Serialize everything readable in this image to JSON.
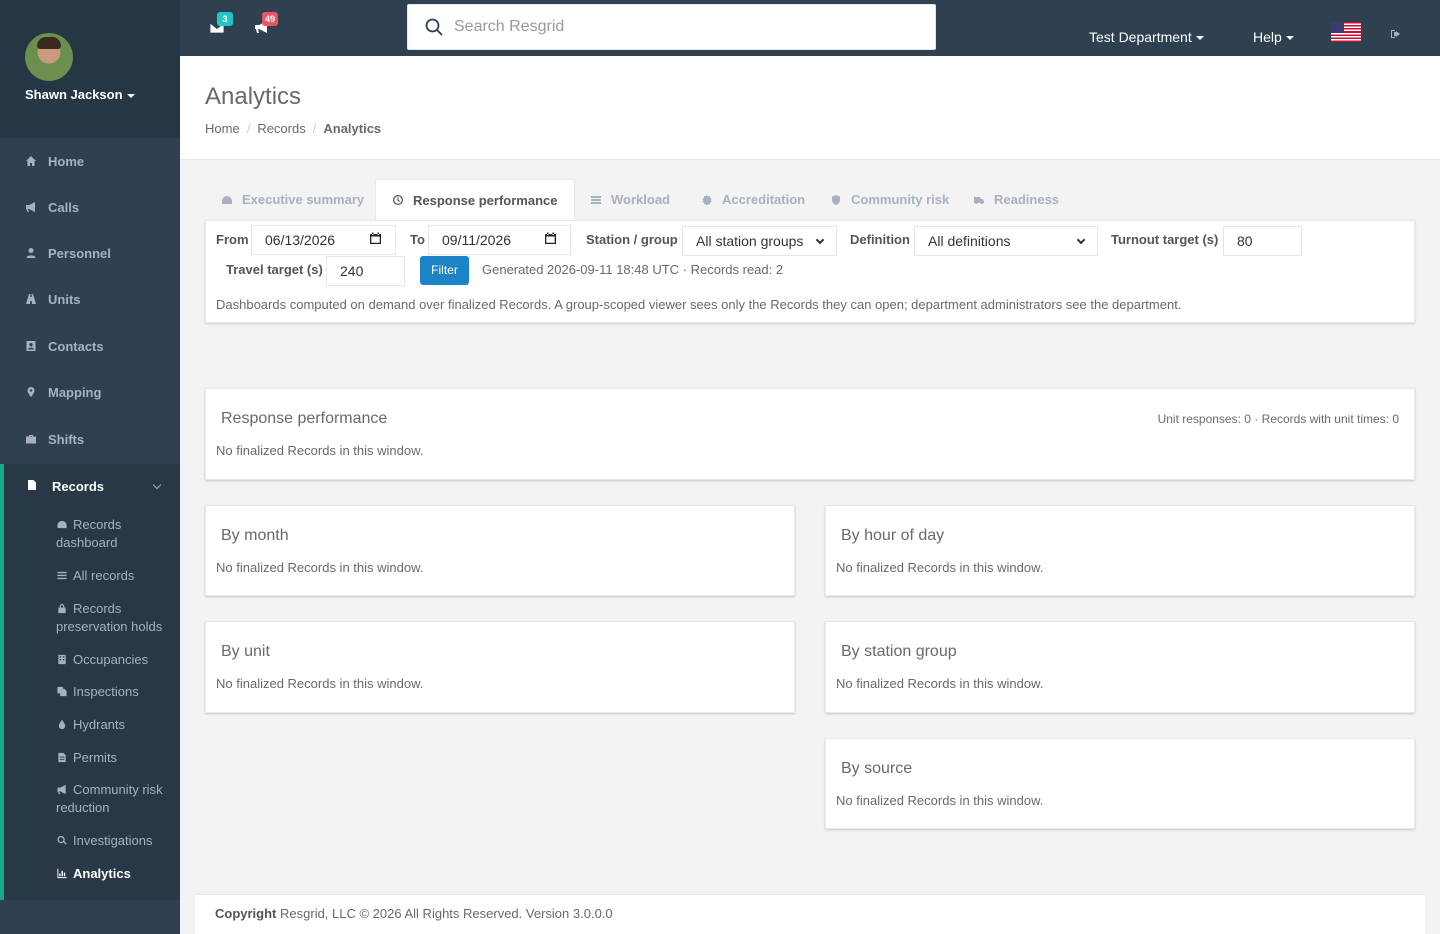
{
  "user": {
    "name": "Shawn Jackson"
  },
  "nav": {
    "home": "Home",
    "calls": "Calls",
    "personnel": "Personnel",
    "units": "Units",
    "contacts": "Contacts",
    "mapping": "Mapping",
    "shifts": "Shifts",
    "records": "Records",
    "records_sub": {
      "dashboard": "Records dashboard",
      "all": "All records",
      "holds": "Records preservation holds",
      "occupancies": "Occupancies",
      "inspections": "Inspections",
      "hydrants": "Hydrants",
      "permits": "Permits",
      "crr": "Community risk reduction",
      "investigations": "Investigations",
      "analytics": "Analytics"
    }
  },
  "topbar": {
    "messages_count": "3",
    "alerts_count": "49",
    "search_placeholder": "Search Resgrid",
    "department": "Test Department",
    "help": "Help",
    "colors": {
      "messages_badge": "#23c6c8",
      "alerts_badge": "#ed5565"
    }
  },
  "page": {
    "title": "Analytics",
    "breadcrumb": [
      "Home",
      "Records",
      "Analytics"
    ]
  },
  "tabs": [
    {
      "label": "Executive summary",
      "icon": "dashboard-icon"
    },
    {
      "label": "Response performance",
      "icon": "clock-icon",
      "active": true
    },
    {
      "label": "Workload",
      "icon": "list-icon"
    },
    {
      "label": "Accreditation",
      "icon": "certificate-icon"
    },
    {
      "label": "Community risk",
      "icon": "shield-icon"
    },
    {
      "label": "Readiness",
      "icon": "truck-icon"
    }
  ],
  "filters": {
    "from_label": "From",
    "from_value": "06/13/2026",
    "to_label": "To",
    "to_value": "09/11/2026",
    "group_label": "Station / group",
    "group_value": "All station groups",
    "definition_label": "Definition",
    "definition_value": "All definitions",
    "turnout_label": "Turnout target (s)",
    "turnout_value": "80",
    "travel_label": "Travel target (s)",
    "travel_value": "240",
    "filter_button": "Filter",
    "generated": "Generated 2026-09-11 18:48 UTC · Records read: 2",
    "description": "Dashboards computed on demand over finalized Records. A group-scoped viewer sees only the Records they can open; department administrators see the department."
  },
  "cards": {
    "response": {
      "title": "Response performance",
      "meta": "Unit responses: 0 · Records with unit times: 0",
      "empty": "No finalized Records in this window."
    },
    "by_month": {
      "title": "By month",
      "empty": "No finalized Records in this window."
    },
    "by_hour": {
      "title": "By hour of day",
      "empty": "No finalized Records in this window."
    },
    "by_unit": {
      "title": "By unit",
      "empty": "No finalized Records in this window."
    },
    "by_station": {
      "title": "By station group",
      "empty": "No finalized Records in this window."
    },
    "by_source": {
      "title": "By source",
      "empty": "No finalized Records in this window."
    }
  },
  "footer": {
    "copyright_label": "Copyright",
    "text": "Resgrid, LLC © 2026 All Rights Reserved.",
    "version": "Version 3.0.0.0"
  }
}
